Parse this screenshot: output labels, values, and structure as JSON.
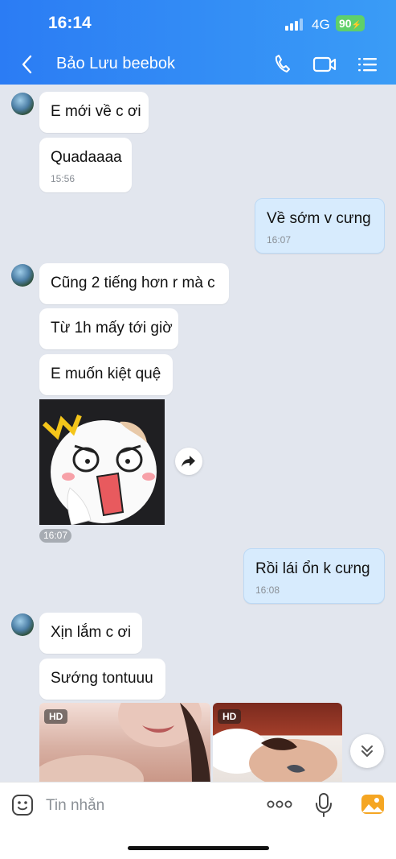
{
  "status_bar": {
    "time": "16:14",
    "network": "4G",
    "battery": "90"
  },
  "header": {
    "contact_name": "Bảo Lưu beebok"
  },
  "icons": {
    "back": "chevron-left-icon",
    "call": "phone-icon",
    "video": "video-camera-icon",
    "menu": "list-menu-icon",
    "forward": "forward-icon",
    "scroll_down": "double-chevron-down-icon",
    "emoji": "emoji-sticker-icon",
    "more": "more-dots-icon",
    "mic": "microphone-icon",
    "gallery": "image-gallery-icon"
  },
  "messages": [
    {
      "text": "E mới về c ơi"
    },
    {
      "text": "Quadaaaa",
      "time": "15:56"
    },
    {
      "text": "Về sớm v cưng",
      "time": "16:07"
    },
    {
      "text": "Cũng 2 tiếng hơn r mà c"
    },
    {
      "text": "Từ 1h mấy tới giờ"
    },
    {
      "text": "E muốn kiệt quệ"
    },
    {
      "time": "16:07"
    },
    {
      "text": "Rồi lái ổn k cưng",
      "time": "16:08"
    },
    {
      "text": "Xịn lắm c ơi"
    },
    {
      "text": "Sướng tontuuu"
    }
  ],
  "photos": [
    {
      "badge": "HD"
    },
    {
      "badge": "HD"
    }
  ],
  "composer": {
    "placeholder": "Tin nhắn"
  },
  "colors": {
    "header_start": "#2b7cf4",
    "header_end": "#3a9cf6",
    "incoming_bubble": "#ffffff",
    "outgoing_bubble": "#d7ebfd",
    "chat_background": "#e2e6ee"
  }
}
